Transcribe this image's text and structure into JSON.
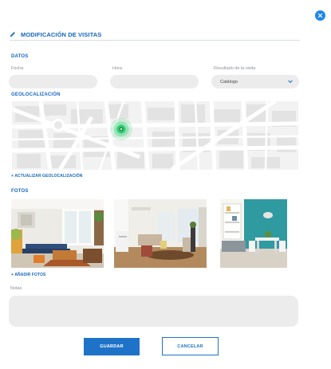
{
  "modal": {
    "title": "MODIFICACIÓN DE VISITAS",
    "close_icon": "close-icon",
    "header_icon": "pencil-icon"
  },
  "datos": {
    "section_label": "DATOS",
    "fecha_label": "Fecha",
    "fecha_value": "",
    "hora_label": "Hora",
    "hora_value": "",
    "resultado_label": "Resultado de la visita",
    "resultado_value": "Catálogo",
    "resultado_icon": "chevron-down-icon"
  },
  "geolocalizacion": {
    "section_label": "GEOLOCALIZACIÓN",
    "marker_icon": "location-marker-icon",
    "update_link": "+ ACTUALIZAR GEOLOCALIZACIÓN"
  },
  "fotos": {
    "section_label": "FOTOS",
    "photos": [
      "living-room-photo",
      "dining-room-photo",
      "teal-wall-room-photo"
    ],
    "add_link": "+ AÑADIR FOTOS"
  },
  "notas": {
    "label": "Notas",
    "value": ""
  },
  "actions": {
    "save_label": "GUARDAR",
    "cancel_label": "CANCELAR"
  },
  "colors": {
    "accent": "#1565c0",
    "button": "#1e73c8",
    "field_bg": "#ececec",
    "marker": "#2ecc71"
  }
}
